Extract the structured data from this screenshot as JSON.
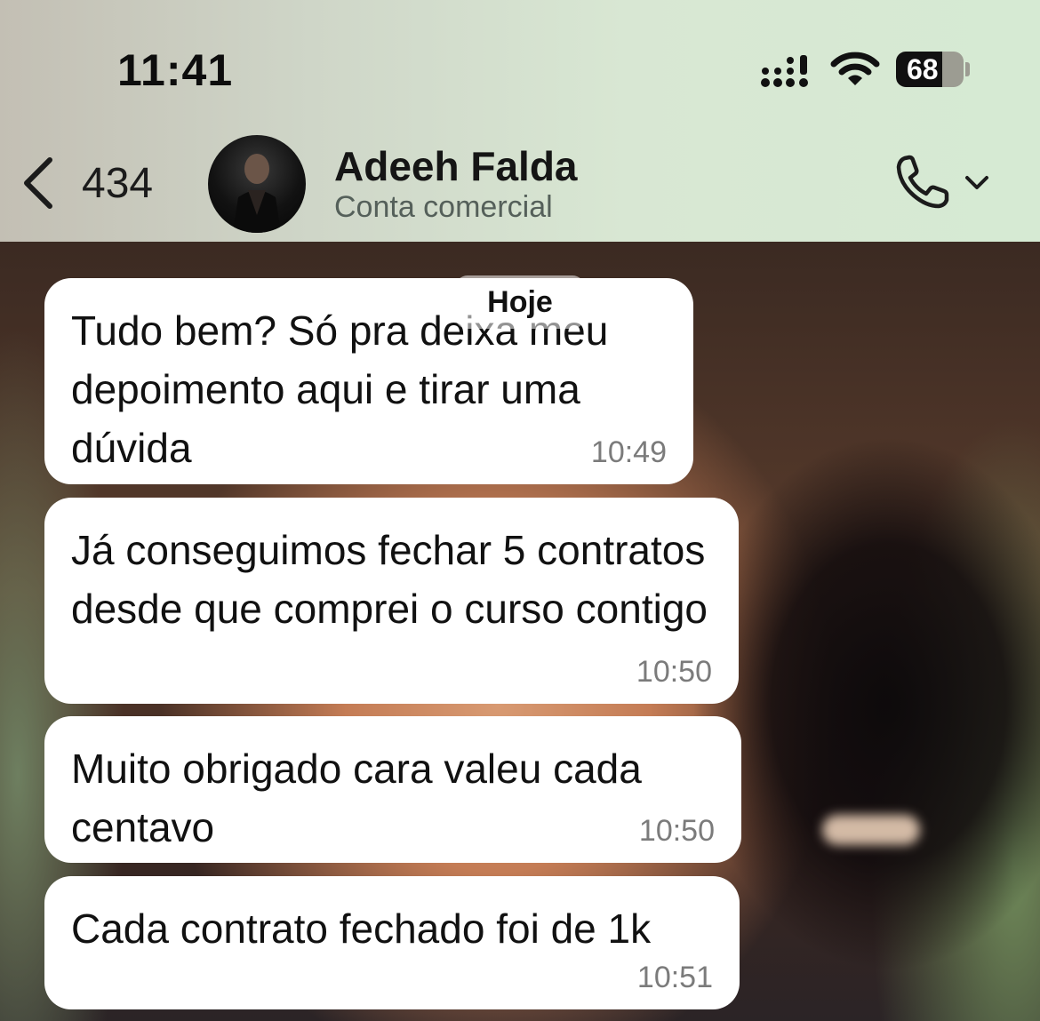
{
  "status_bar": {
    "time": "11:41",
    "battery": "68",
    "battery_level": 0.68
  },
  "header": {
    "back_count": "434",
    "contact_name": "Adeeh Falda",
    "contact_subtitle": "Conta comercial"
  },
  "chat": {
    "date_label": "Hoje",
    "messages": [
      {
        "text": "Tudo bem? Só pra deixa meu depoimento aqui e tirar uma dúvida",
        "time": "10:49"
      },
      {
        "text": "Já conseguimos fechar 5 contratos desde que comprei o curso contigo",
        "time": "10:50"
      },
      {
        "text": "Muito obrigado cara valeu cada centavo",
        "time": "10:50"
      },
      {
        "text": "Cada contrato fechado foi de 1k",
        "time": "10:51"
      }
    ]
  },
  "icons": {
    "back": "chevron-left-icon",
    "call": "phone-icon",
    "call_menu": "chevron-down-icon",
    "signal": "cellular-signal-icon",
    "wifi": "wifi-icon",
    "battery": "battery-icon"
  },
  "colors": {
    "header_bg": "#d8e7d3",
    "bubble_bg": "#ffffff",
    "text": "#111111",
    "time_text": "#7b7b7b"
  }
}
